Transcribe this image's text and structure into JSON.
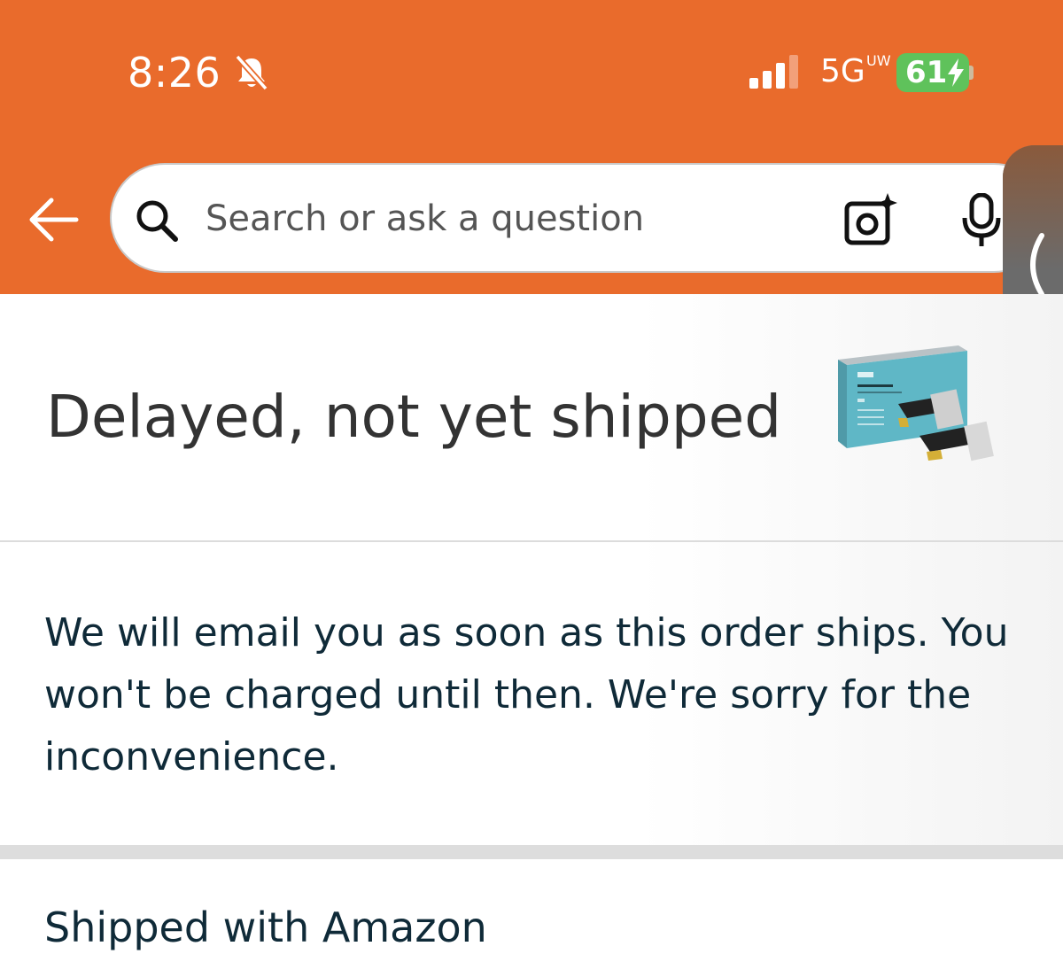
{
  "status_bar": {
    "time": "8:26",
    "network": "5G",
    "network_sup": "UW",
    "battery": "61"
  },
  "header": {
    "background_color": "#e96b2c",
    "search_placeholder": "Search or ask a question",
    "icons": [
      "back-arrow-icon",
      "search-icon",
      "camera-icon",
      "microphone-icon"
    ]
  },
  "order": {
    "status_title": "Delayed, not yet shipped",
    "message": "We will email you as soon as this order ships. You won't be charged until then. We're sorry for the inconvenience.",
    "shipped_with": "Shipped with Amazon"
  },
  "colors": {
    "header": "#e96b2c",
    "battery": "#5fc25b",
    "text_dark": "#0f2a38"
  }
}
